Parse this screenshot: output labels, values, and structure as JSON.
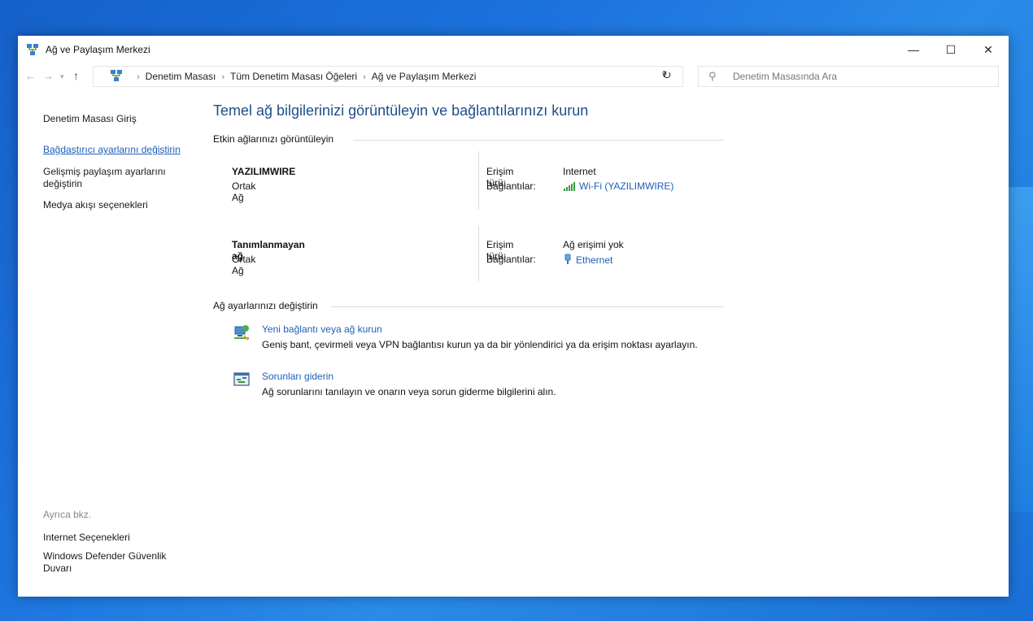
{
  "window": {
    "title": "Ağ ve Paylaşım Merkezi",
    "controls": {
      "minimize": "—",
      "maximize": "☐",
      "close": "✕"
    }
  },
  "address": {
    "breadcrumbs": [
      "Denetim Masası",
      "Tüm Denetim Masası Öğeleri",
      "Ağ ve Paylaşım Merkezi"
    ],
    "search_placeholder": "Denetim Masasında Ara"
  },
  "sidebar": {
    "home": "Denetim Masası Giriş",
    "adapter": "Bağdaştırıcı ayarlarını değiştirin",
    "sharing": "Gelişmiş paylaşım ayarlarını değiştirin",
    "media": "Medya akışı seçenekleri",
    "see_also": "Ayrıca bkz.",
    "internet_options": "Internet Seçenekleri",
    "defender": "Windows Defender Güvenlik Duvarı"
  },
  "main": {
    "title": "Temel ağ bilgilerinizi görüntüleyin ve bağlantılarınızı kurun",
    "active_section": "Etkin ağlarınızı görüntüleyin",
    "networks": [
      {
        "name": "YAZILIMWIRE",
        "type": "Ortak Ağ",
        "access_label": "Erişim türü:",
        "access_value": "Internet",
        "conn_label": "Bağlantılar:",
        "conn_value": "Wi-Fi (YAZILIMWIRE)",
        "conn_icon": "wifi-signal-icon"
      },
      {
        "name": "Tanımlanmayan ağ",
        "type": "Ortak Ağ",
        "access_label": "Erişim türü:",
        "access_value": "Ağ erişimi yok",
        "conn_label": "Bağlantılar:",
        "conn_value": "Ethernet",
        "conn_icon": "ethernet-icon"
      }
    ],
    "settings_section": "Ağ ayarlarınızı değiştirin",
    "tasks": [
      {
        "link": "Yeni bağlantı veya ağ kurun",
        "desc": "Geniş bant, çevirmeli veya VPN bağlantısı kurun ya da bir yönlendirici ya da erişim noktası ayarlayın.",
        "icon": "new-connection-icon"
      },
      {
        "link": "Sorunları giderin",
        "desc": "Ağ sorunlarını tanılayın ve onarın veya sorun giderme bilgilerini alın.",
        "icon": "troubleshoot-icon"
      }
    ]
  },
  "colors": {
    "link": "#1e5fb8",
    "title": "#1e4e8c",
    "desktop": "#1d73de"
  }
}
